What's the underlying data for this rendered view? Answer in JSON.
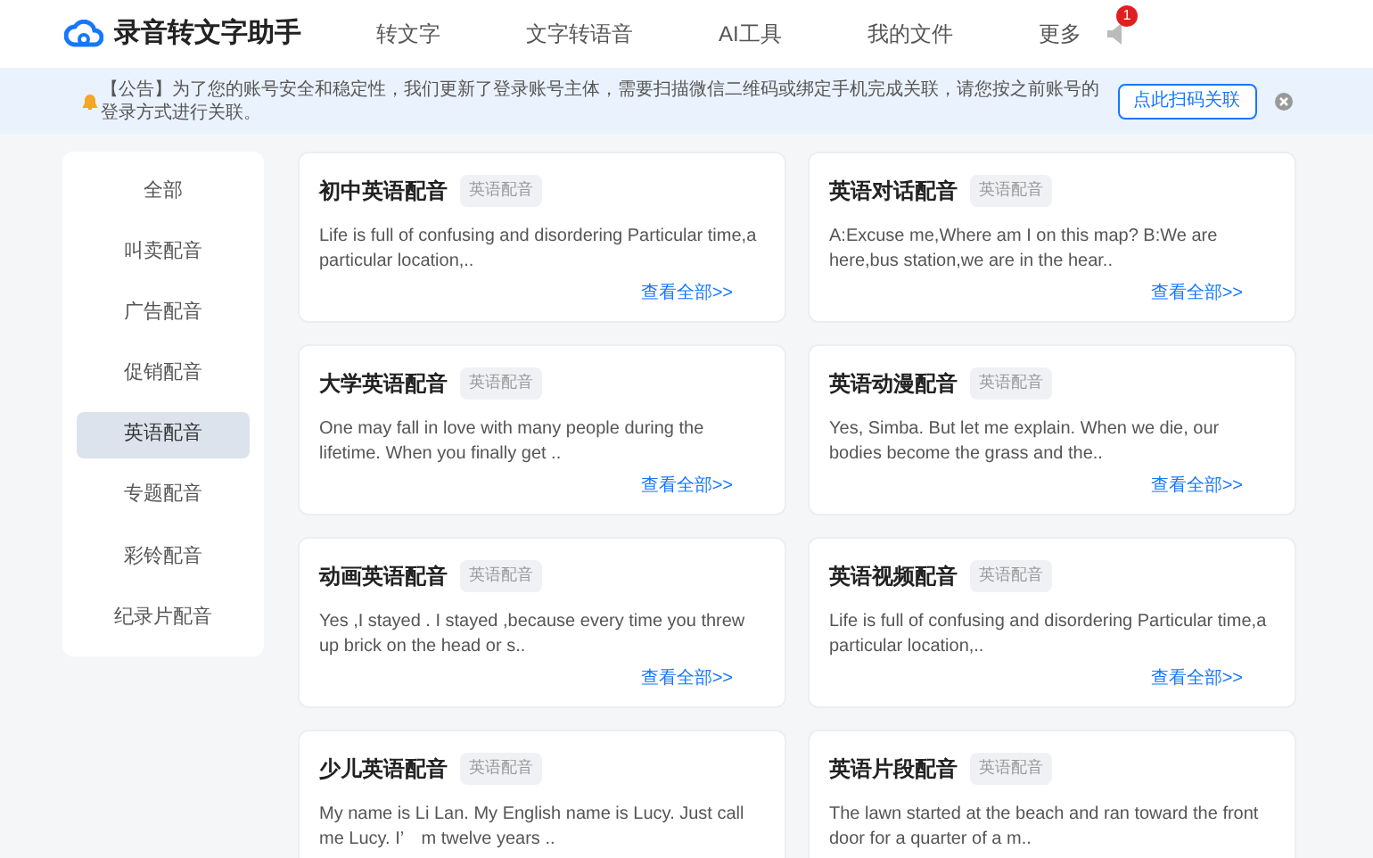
{
  "header": {
    "logo_text": "录音转文字助手",
    "nav": [
      {
        "label": "转文字"
      },
      {
        "label": "文字转语音"
      },
      {
        "label": "AI工具"
      },
      {
        "label": "我的文件"
      },
      {
        "label": "更多"
      }
    ],
    "notification_badge": "1"
  },
  "notice": {
    "text": "【公告】为了您的账号安全和稳定性，我们更新了登录账号主体，需要扫描微信二维码或绑定手机完成关联，请您按之前账号的登录方式进行关联。",
    "button": "点此扫码关联"
  },
  "sidebar": {
    "items": [
      {
        "label": "全部",
        "selected": false
      },
      {
        "label": "叫卖配音",
        "selected": false
      },
      {
        "label": "广告配音",
        "selected": false
      },
      {
        "label": "促销配音",
        "selected": false
      },
      {
        "label": "英语配音",
        "selected": true
      },
      {
        "label": "专题配音",
        "selected": false
      },
      {
        "label": "彩铃配音",
        "selected": false
      },
      {
        "label": "纪录片配音",
        "selected": false
      }
    ]
  },
  "cards": [
    {
      "title": "初中英语配音",
      "tag": "英语配音",
      "text": "Life is full of confusing and disordering Particular time,a particular location,..",
      "link": "查看全部>>"
    },
    {
      "title": "英语对话配音",
      "tag": "英语配音",
      "text": "A:Excuse me,Where am I on this map? B:We are here,bus station,we are in the hear..",
      "link": "查看全部>>"
    },
    {
      "title": "大学英语配音",
      "tag": "英语配音",
      "text": "One may fall in love with many people during the lifetime. When you finally get ..",
      "link": "查看全部>>"
    },
    {
      "title": "英语动漫配音",
      "tag": "英语配音",
      "text": "Yes, Simba. But let me explain. When we die, our bodies become the grass and the..",
      "link": "查看全部>>"
    },
    {
      "title": "动画英语配音",
      "tag": "英语配音",
      "text": "Yes ,I stayed . I stayed ,because every time you threw up brick on the head or s..",
      "link": "查看全部>>"
    },
    {
      "title": "英语视频配音",
      "tag": "英语配音",
      "text": "Life is full of confusing and disordering Particular time,a particular location,..",
      "link": "查看全部>>"
    },
    {
      "title": "少儿英语配音",
      "tag": "英语配音",
      "text": "My name is Li Lan. My English name is Lucy. Just call me Lucy. I’　m twelve years .."
    },
    {
      "title": "英语片段配音",
      "tag": "英语配音",
      "text": "The lawn started at the beach and ran toward the front door for a quarter of a m.."
    }
  ]
}
